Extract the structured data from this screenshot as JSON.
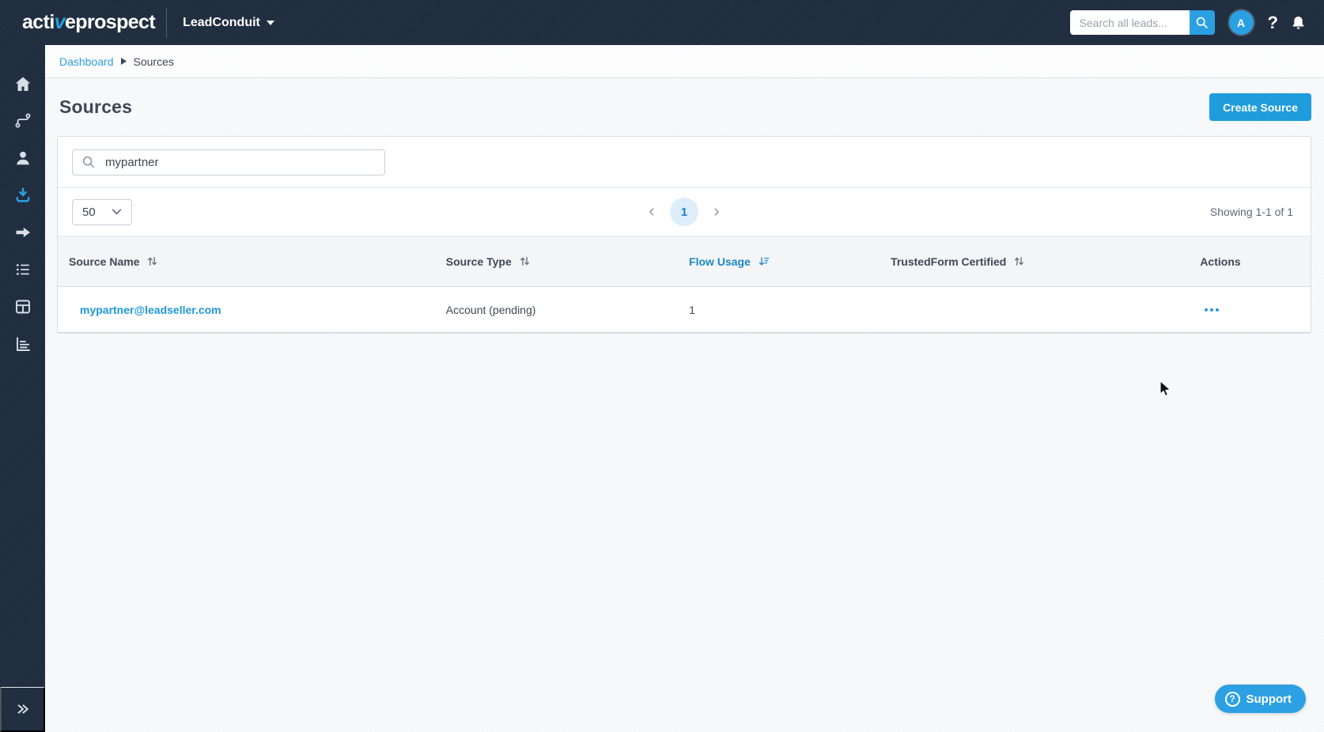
{
  "colors": {
    "navy": "#1f2d3f",
    "accent_blue": "#2aa0e2",
    "link_blue": "#1e98d9",
    "sorted_header_blue": "#1d86c8",
    "text_dark": "#3e4854",
    "text_gray": "#5d6874",
    "border": "#d9dee3",
    "header_band_bg": "#f3f5f7",
    "page_bg": "#f8f9fb",
    "pagination_active_bg": "#ddeefa"
  },
  "topbar": {
    "logo_part1": "acti",
    "logo_accent": "v",
    "logo_part2": "eprospect",
    "product": "LeadConduit",
    "search_placeholder": "Search all leads...",
    "avatar_initial": "A",
    "help_glyph": "?"
  },
  "sidebar": {
    "items": [
      {
        "icon": "home-icon",
        "active": false
      },
      {
        "icon": "flows-icon",
        "active": false
      },
      {
        "icon": "contacts-icon",
        "active": false
      },
      {
        "icon": "sources-icon",
        "active": true
      },
      {
        "icon": "recipients-icon",
        "active": false
      },
      {
        "icon": "lists-icon",
        "active": false
      },
      {
        "icon": "tables-icon",
        "active": false
      },
      {
        "icon": "reports-icon",
        "active": false
      }
    ],
    "expand_icon": "double-chevron-right"
  },
  "breadcrumb": {
    "items": [
      "Dashboard",
      "Sources"
    ]
  },
  "page": {
    "title": "Sources",
    "create_button_label": "Create Source"
  },
  "filters": {
    "search_value": "mypartner",
    "page_size": "50"
  },
  "pagination": {
    "current_page": "1",
    "showing_text": "Showing 1-1 of 1"
  },
  "table": {
    "columns": [
      {
        "label": "Source Name",
        "sort": "none"
      },
      {
        "label": "Source Type",
        "sort": "none"
      },
      {
        "label": "Flow Usage",
        "sort": "desc"
      },
      {
        "label": "TrustedForm Certified",
        "sort": "none"
      },
      {
        "label": "Actions",
        "sort": null
      }
    ],
    "rows": [
      {
        "source_name": "mypartner@leadseller.com",
        "source_type": "Account (pending)",
        "flow_usage": "1",
        "trustedform_certified": ""
      }
    ]
  },
  "support": {
    "label": "Support",
    "icon_glyph": "?"
  }
}
